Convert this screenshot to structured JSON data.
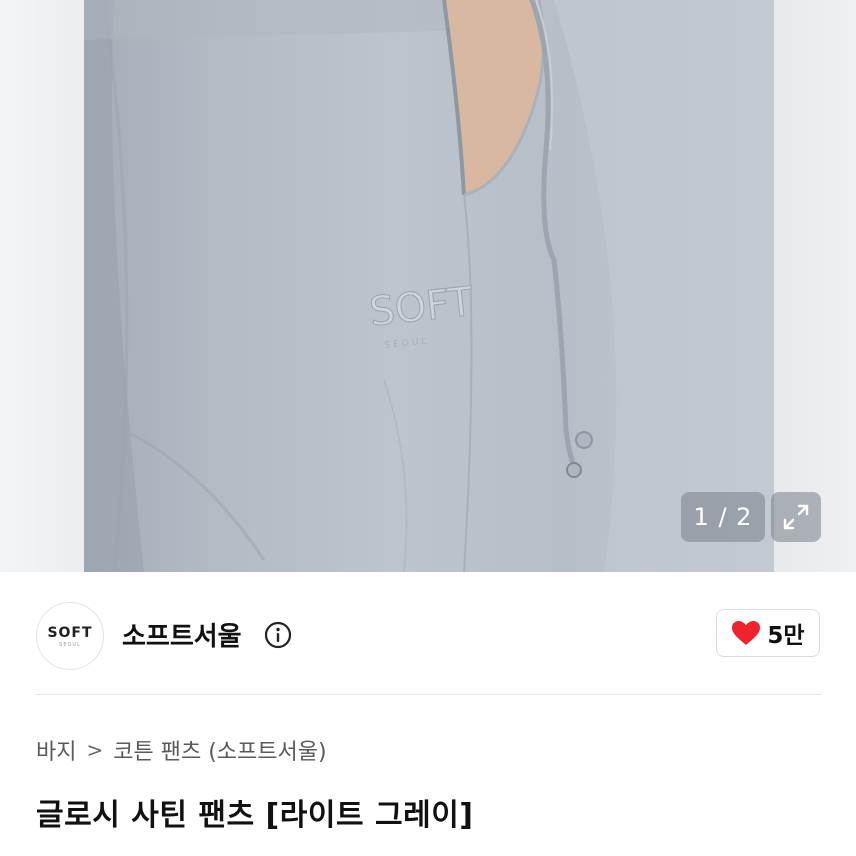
{
  "gallery": {
    "counter": "1 / 2",
    "brand_embroidery": "SOFT"
  },
  "seller": {
    "logo_text": "SOFT",
    "logo_sub": "SEOUL",
    "name": "소프트서울",
    "like_count": "5만"
  },
  "breadcrumb": {
    "items": [
      "바지",
      "코튼 팬츠 (소프트서울)"
    ],
    "separator": ">"
  },
  "product": {
    "title": "글로시 사틴 팬츠 [라이트 그레이]"
  },
  "colors": {
    "heart": "#f0222e",
    "fabric": "#b8c1ca"
  },
  "icons": {
    "expand": "expand-icon",
    "info": "info-icon",
    "heart": "heart-icon"
  }
}
